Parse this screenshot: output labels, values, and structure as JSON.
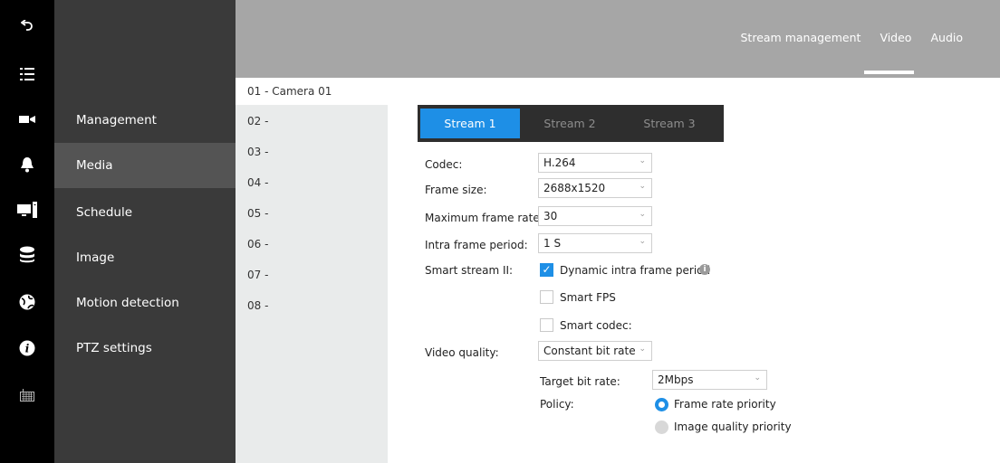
{
  "rail": {
    "icons": [
      "back-arrow-icon",
      "list-icon",
      "video-camera-icon",
      "bell-icon",
      "monitor-icon",
      "database-icon",
      "globe-icon",
      "info-icon",
      "keyboard-icon"
    ]
  },
  "menu": {
    "items": [
      {
        "label": "Management"
      },
      {
        "label": "Media"
      },
      {
        "label": "Schedule"
      },
      {
        "label": "Image"
      },
      {
        "label": "Motion detection"
      },
      {
        "label": "PTZ settings"
      }
    ]
  },
  "top_tabs": [
    {
      "label": "Stream management"
    },
    {
      "label": "Video"
    },
    {
      "label": "Audio"
    }
  ],
  "channels": [
    "01 - Camera 01",
    "02 -",
    "03 -",
    "04 -",
    "05 -",
    "06 -",
    "07 -",
    "08 -"
  ],
  "stream_tabs": [
    "Stream 1",
    "Stream 2",
    "Stream 3"
  ],
  "form": {
    "codec_label": "Codec:",
    "codec_value": "H.264",
    "frame_size_label": "Frame size:",
    "frame_size_value": "2688x1520",
    "max_frame_rate_label": "Maximum frame rate:",
    "max_frame_rate_value": "30",
    "intra_label": "Intra frame period:",
    "intra_value": "1 S",
    "smart_stream_label": "Smart stream II:",
    "dynamic_intra_label": "Dynamic intra frame period",
    "smart_fps_label": "Smart FPS",
    "smart_codec_label": "Smart codec:",
    "video_quality_label": "Video quality:",
    "video_quality_value": "Constant bit rate",
    "target_bit_rate_label": "Target bit rate:",
    "target_bit_rate_value": "2Mbps",
    "policy_label": "Policy:",
    "policy_option1": "Frame rate priority",
    "policy_option2": "Image quality priority"
  },
  "colors": {
    "accent": "#1e8fe6",
    "rail": "#000000",
    "menu": "#3a3a3a",
    "menu_active": "#545454",
    "topbar": "#a6a6a6",
    "channel_list": "#e9ebeb"
  }
}
